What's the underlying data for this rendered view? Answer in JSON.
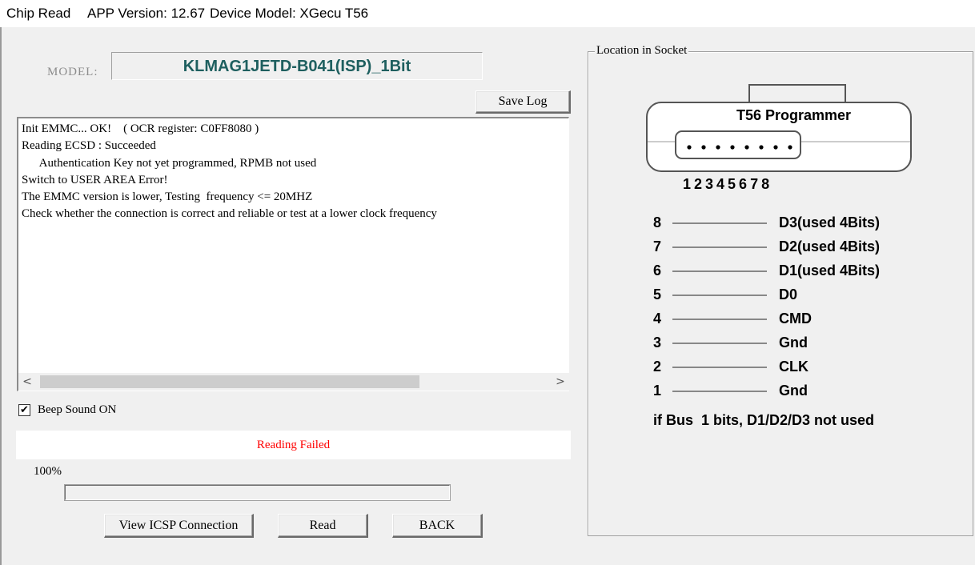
{
  "window": {
    "title": "Chip Read",
    "app_version": "APP Version: 12.67",
    "device_model": "Device Model: XGecu T56"
  },
  "model": {
    "label": "MODEL:",
    "value": "KLMAG1JETD-B041(ISP)_1Bit"
  },
  "buttons": {
    "save_log": "Save Log",
    "view_icsp": "View ICSP Connection",
    "read": "Read",
    "back": "BACK"
  },
  "log": {
    "lines": [
      "Init EMMC... OK!    ( OCR register: C0FF8080 )",
      "Reading ECSD : Succeeded",
      "      Authentication Key not yet programmed, RPMB not used",
      "Switch to USER AREA Error!",
      "The EMMC version is lower, Testing  frequency <= 20MHZ",
      "Check whether the connection is correct and reliable or test at a lower clock frequency"
    ]
  },
  "beep": {
    "label": "Beep Sound ON",
    "checked": true,
    "check_glyph": "✔"
  },
  "status": {
    "text": "Reading Failed",
    "color": "#ff0000"
  },
  "progress": {
    "percent_text": "100%",
    "fraction": 1.0
  },
  "socket": {
    "group_title": "Location in Socket",
    "programmer_label": "T56 Programmer",
    "pin_numbers": "1 2 3 4 5 6 7 8",
    "pins": [
      {
        "num": "8",
        "signal": "D3(used 4Bits)"
      },
      {
        "num": "7",
        "signal": "D2(used 4Bits)"
      },
      {
        "num": "6",
        "signal": "D1(used 4Bits)"
      },
      {
        "num": "5",
        "signal": "D0"
      },
      {
        "num": "4",
        "signal": "CMD"
      },
      {
        "num": "3",
        "signal": "Gnd"
      },
      {
        "num": "2",
        "signal": "CLK"
      },
      {
        "num": "1",
        "signal": "Gnd"
      }
    ],
    "bus_note": "if Bus  1 bits, D1/D2/D3 not used"
  },
  "scroll": {
    "left_arrow": "<",
    "right_arrow": ">"
  }
}
